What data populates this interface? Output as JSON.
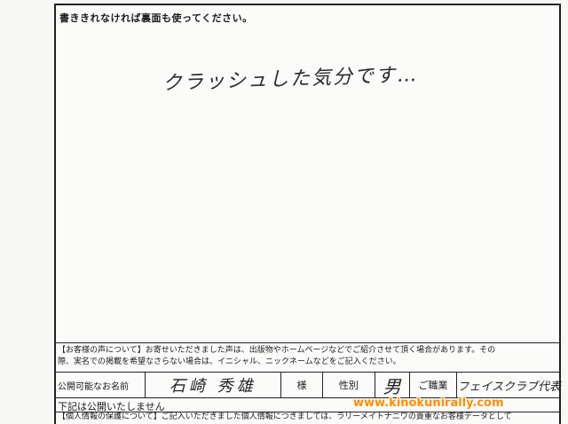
{
  "header": {
    "instruction": "書ききれなければ裏面も使ってください。"
  },
  "comment": {
    "handwritten": "クラッシュした気分です…"
  },
  "notice": {
    "line1": "【お客様の声について】お寄せいただきました声は、出版物やホームページなどでご紹介させて頂く場合があります。その",
    "line2": "際、実名での掲載を希望なさらない場合は、イニシャル、ニックネームなどをご記入ください。"
  },
  "form": {
    "name_label": "公開可能なお名前",
    "name_value": "石崎 秀雄",
    "honorific": "様",
    "gender_label": "性別",
    "gender_value": "男",
    "occupation_label": "ご職業",
    "occupation_value": "フェイスクラブ代表"
  },
  "footer": {
    "heading": "下記は公開いたしません",
    "privacy": "【個人情報の保護について】ご記入いただきました個人情報につきましては、ラリーメイトナニワの貴重なお客様データとして"
  },
  "watermark": {
    "url": "www.kinokunirally.com"
  }
}
